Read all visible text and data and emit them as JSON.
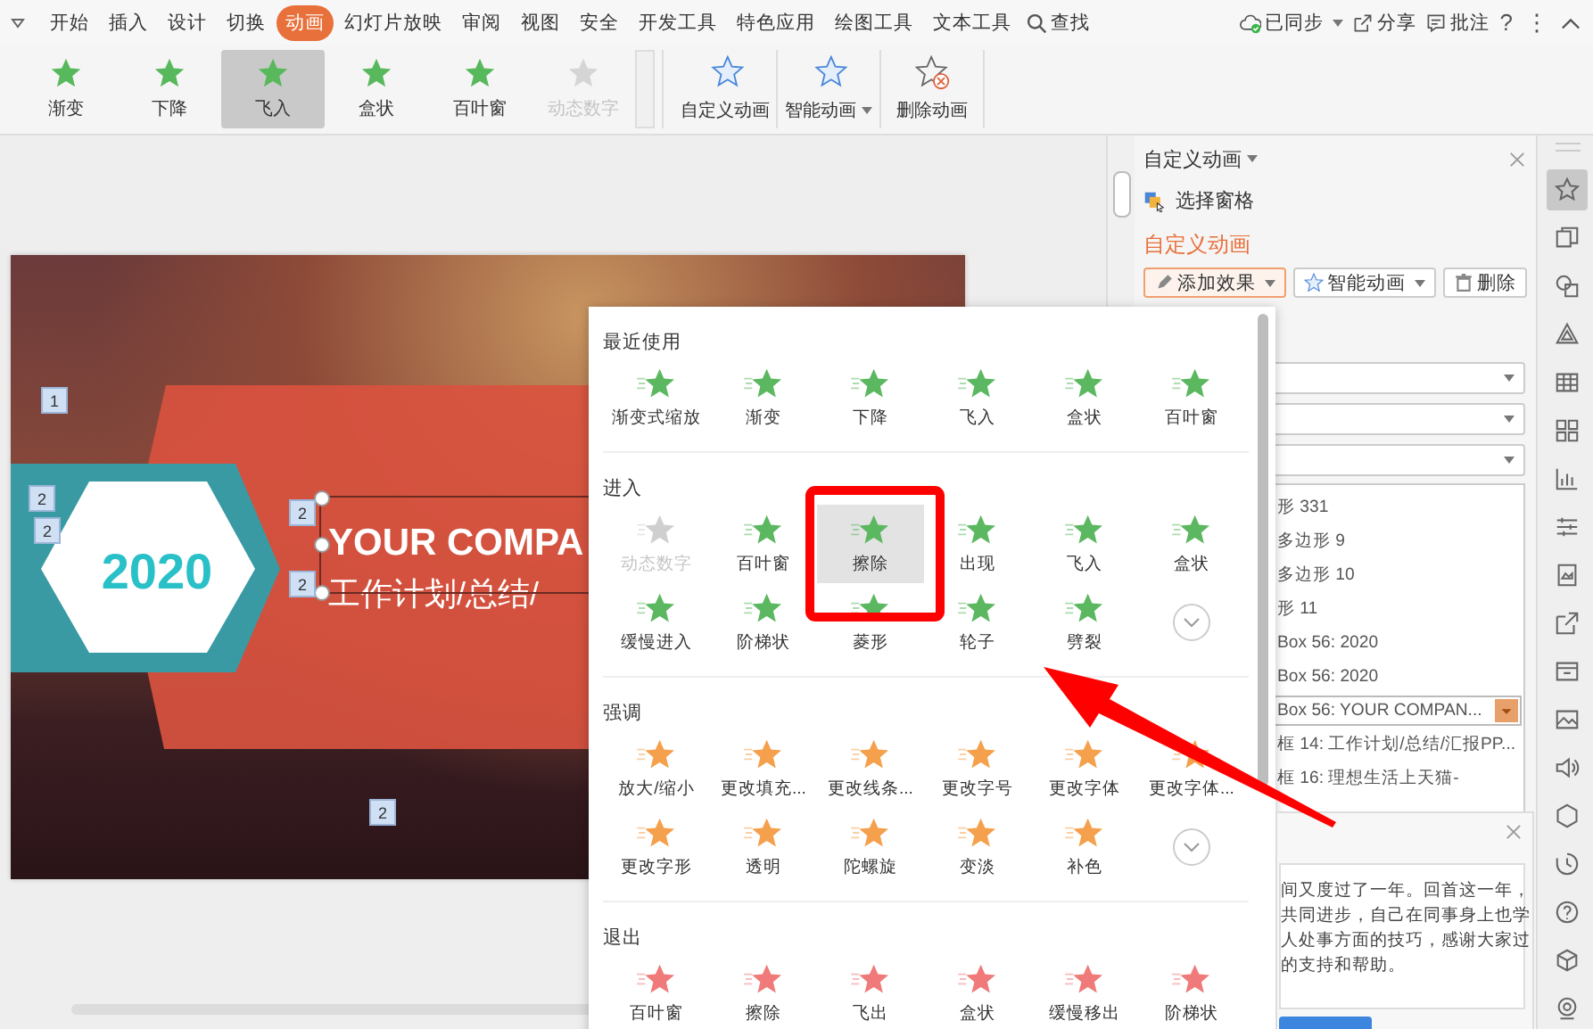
{
  "menu_tabs": [
    {
      "label": "开始",
      "selected": false
    },
    {
      "label": "插入",
      "selected": false
    },
    {
      "label": "设计",
      "selected": false
    },
    {
      "label": "切换",
      "selected": false
    },
    {
      "label": "动画",
      "selected": true
    },
    {
      "label": "幻灯片放映",
      "selected": false
    },
    {
      "label": "审阅",
      "selected": false
    },
    {
      "label": "视图",
      "selected": false
    },
    {
      "label": "安全",
      "selected": false
    },
    {
      "label": "开发工具",
      "selected": false
    },
    {
      "label": "特色应用",
      "selected": false
    },
    {
      "label": "绘图工具",
      "selected": false
    },
    {
      "label": "文本工具",
      "selected": false
    }
  ],
  "search": {
    "label": "查找"
  },
  "menu_actions": [
    {
      "kind": "sync",
      "label": "已同步",
      "caret": true
    },
    {
      "kind": "share",
      "label": "分享",
      "caret": false
    },
    {
      "kind": "comment",
      "label": "批注",
      "caret": false
    }
  ],
  "menu_symbols": [
    "?",
    "⋮"
  ],
  "ribbon": {
    "gallery": [
      {
        "label": "渐变",
        "selected": false,
        "disabled": false
      },
      {
        "label": "下降",
        "selected": false,
        "disabled": false
      },
      {
        "label": "飞入",
        "selected": true,
        "disabled": false
      },
      {
        "label": "盒状",
        "selected": false,
        "disabled": false
      },
      {
        "label": "百叶窗",
        "selected": false,
        "disabled": false
      },
      {
        "label": "动态数字",
        "selected": false,
        "disabled": true
      }
    ],
    "buttons": [
      {
        "label": "自定义动画",
        "kind": "custom",
        "caret": false
      },
      {
        "label": "智能动画",
        "kind": "smart",
        "caret": true
      },
      {
        "label": "删除动画",
        "kind": "delete",
        "caret": false
      }
    ]
  },
  "slide": {
    "year": "2020",
    "title": "YOUR COMPA",
    "subtitle": "工作计划/总结/",
    "order_tags": [
      "1",
      "2",
      "2",
      "2",
      "2",
      "2"
    ]
  },
  "effects_menu": {
    "sections": [
      {
        "title": "最近使用",
        "kind": "recent",
        "expandable": false,
        "items": [
          {
            "label": "渐变式缩放",
            "selected": false,
            "disabled": false
          },
          {
            "label": "渐变",
            "selected": false,
            "disabled": false
          },
          {
            "label": "下降",
            "selected": false,
            "disabled": false
          },
          {
            "label": "飞入",
            "selected": false,
            "disabled": false
          },
          {
            "label": "盒状",
            "selected": false,
            "disabled": false
          },
          {
            "label": "百叶窗",
            "selected": false,
            "disabled": false
          }
        ]
      },
      {
        "title": "进入",
        "kind": "entrance",
        "expandable": true,
        "items": [
          {
            "label": "动态数字",
            "selected": false,
            "disabled": true
          },
          {
            "label": "百叶窗",
            "selected": false,
            "disabled": false
          },
          {
            "label": "擦除",
            "selected": true,
            "disabled": false
          },
          {
            "label": "出现",
            "selected": false,
            "disabled": false
          },
          {
            "label": "飞入",
            "selected": false,
            "disabled": false
          },
          {
            "label": "盒状",
            "selected": false,
            "disabled": false
          },
          {
            "label": "缓慢进入",
            "selected": false,
            "disabled": false
          },
          {
            "label": "阶梯状",
            "selected": false,
            "disabled": false
          },
          {
            "label": "菱形",
            "selected": false,
            "disabled": false
          },
          {
            "label": "轮子",
            "selected": false,
            "disabled": false
          },
          {
            "label": "劈裂",
            "selected": false,
            "disabled": false
          }
        ]
      },
      {
        "title": "强调",
        "kind": "emphasis",
        "expandable": true,
        "items": [
          {
            "label": "放大/缩小",
            "selected": false,
            "disabled": false
          },
          {
            "label": "更改填充...",
            "selected": false,
            "disabled": false
          },
          {
            "label": "更改线条...",
            "selected": false,
            "disabled": false
          },
          {
            "label": "更改字号",
            "selected": false,
            "disabled": false
          },
          {
            "label": "更改字体",
            "selected": false,
            "disabled": false
          },
          {
            "label": "更改字体...",
            "selected": false,
            "disabled": false
          },
          {
            "label": "更改字形",
            "selected": false,
            "disabled": false
          },
          {
            "label": "透明",
            "selected": false,
            "disabled": false
          },
          {
            "label": "陀螺旋",
            "selected": false,
            "disabled": false
          },
          {
            "label": "变淡",
            "selected": false,
            "disabled": false
          },
          {
            "label": "补色",
            "selected": false,
            "disabled": false
          }
        ]
      },
      {
        "title": "退出",
        "kind": "exit",
        "expandable": false,
        "items": [
          {
            "label": "百叶窗",
            "selected": false,
            "disabled": false
          },
          {
            "label": "擦除",
            "selected": false,
            "disabled": false
          },
          {
            "label": "飞出",
            "selected": false,
            "disabled": false
          },
          {
            "label": "盒状",
            "selected": false,
            "disabled": false
          },
          {
            "label": "缓慢移出",
            "selected": false,
            "disabled": false
          },
          {
            "label": "阶梯状",
            "selected": false,
            "disabled": false
          }
        ]
      }
    ]
  },
  "task_pane": {
    "title": "自定义动画",
    "select_pane": "选择窗格",
    "heading": "自定义动画",
    "buttons": [
      {
        "label": "添加效果",
        "kind": "add",
        "caret": true
      },
      {
        "label": "智能动画",
        "kind": "smart",
        "caret": true
      },
      {
        "label": "删除",
        "kind": "delete",
        "caret": false
      }
    ],
    "animation_list": [
      {
        "label": "形 331",
        "selected": false
      },
      {
        "label": "多边形 9",
        "selected": false
      },
      {
        "label": "多边形 10",
        "selected": false
      },
      {
        "label": "形 11",
        "selected": false
      },
      {
        "label": "Box 56: 2020",
        "selected": false
      },
      {
        "label": "Box 56: 2020",
        "selected": false
      },
      {
        "label": "Box 56: YOUR COMPAN...",
        "selected": true
      },
      {
        "label": "框 14: 工作计划/总结/汇报PP...",
        "selected": false
      },
      {
        "label": "框 16: 理想生活上天猫-",
        "selected": false
      }
    ]
  },
  "note": {
    "lines": [
      "间又度过了一年。回首这一年，",
      "共同进步，自己在同事身上也学",
      "人处事方面的技巧，感谢大家过",
      "的支持和帮助。"
    ]
  },
  "side_tools": [
    {
      "selected": true
    },
    {
      "selected": false
    },
    {
      "selected": false
    },
    {
      "selected": false
    },
    {
      "selected": false
    },
    {
      "selected": false
    },
    {
      "selected": false
    },
    {
      "selected": false
    },
    {
      "selected": false
    },
    {
      "selected": false
    },
    {
      "selected": false
    },
    {
      "selected": false
    },
    {
      "selected": false
    },
    {
      "selected": false
    },
    {
      "selected": false
    },
    {
      "selected": false
    },
    {
      "selected": false
    },
    {
      "selected": false
    }
  ]
}
